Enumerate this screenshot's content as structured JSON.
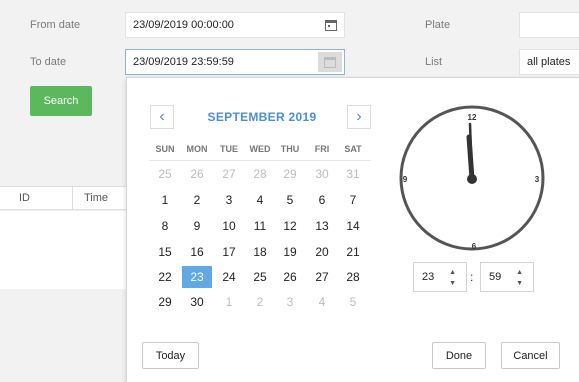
{
  "filters": {
    "from_label": "From date",
    "from_value": "23/09/2019 00:00:00",
    "to_label": "To date",
    "to_value": "23/09/2019 23:59:59",
    "plate_label": "Plate",
    "plate_value": "",
    "list_label": "List",
    "list_value": "all plates",
    "search_label": "Search"
  },
  "results": {
    "columns": [
      "ID",
      "Time"
    ]
  },
  "calendar": {
    "month_title": "SEPTEMBER 2019",
    "prev": "‹",
    "next": "›",
    "weekdays": [
      "SUN",
      "MON",
      "TUE",
      "WED",
      "THU",
      "FRI",
      "SAT"
    ],
    "weeks": [
      [
        {
          "d": "25",
          "m": true
        },
        {
          "d": "26",
          "m": true
        },
        {
          "d": "27",
          "m": true
        },
        {
          "d": "28",
          "m": true
        },
        {
          "d": "29",
          "m": true
        },
        {
          "d": "30",
          "m": true
        },
        {
          "d": "31",
          "m": true
        }
      ],
      [
        {
          "d": "1"
        },
        {
          "d": "2"
        },
        {
          "d": "3"
        },
        {
          "d": "4"
        },
        {
          "d": "5"
        },
        {
          "d": "6"
        },
        {
          "d": "7"
        }
      ],
      [
        {
          "d": "8"
        },
        {
          "d": "9"
        },
        {
          "d": "10"
        },
        {
          "d": "11"
        },
        {
          "d": "12"
        },
        {
          "d": "13"
        },
        {
          "d": "14"
        }
      ],
      [
        {
          "d": "15"
        },
        {
          "d": "16"
        },
        {
          "d": "17"
        },
        {
          "d": "18"
        },
        {
          "d": "19"
        },
        {
          "d": "20"
        },
        {
          "d": "21"
        }
      ],
      [
        {
          "d": "22"
        },
        {
          "d": "23",
          "s": true
        },
        {
          "d": "24"
        },
        {
          "d": "25"
        },
        {
          "d": "26"
        },
        {
          "d": "27"
        },
        {
          "d": "28"
        }
      ],
      [
        {
          "d": "29"
        },
        {
          "d": "30"
        },
        {
          "d": "1",
          "m": true
        },
        {
          "d": "2",
          "m": true
        },
        {
          "d": "3",
          "m": true
        },
        {
          "d": "4",
          "m": true
        },
        {
          "d": "5",
          "m": true
        }
      ]
    ],
    "selected_day": "23"
  },
  "clock": {
    "numerals": [
      "12",
      "3",
      "6",
      "9"
    ],
    "hour": "23",
    "minute": "59",
    "separator": ":"
  },
  "buttons": {
    "today": "Today",
    "done": "Done",
    "cancel": "Cancel"
  },
  "colors": {
    "accent": "#4a90d9",
    "selected": "#62a8e3",
    "search": "#5cb85c"
  }
}
